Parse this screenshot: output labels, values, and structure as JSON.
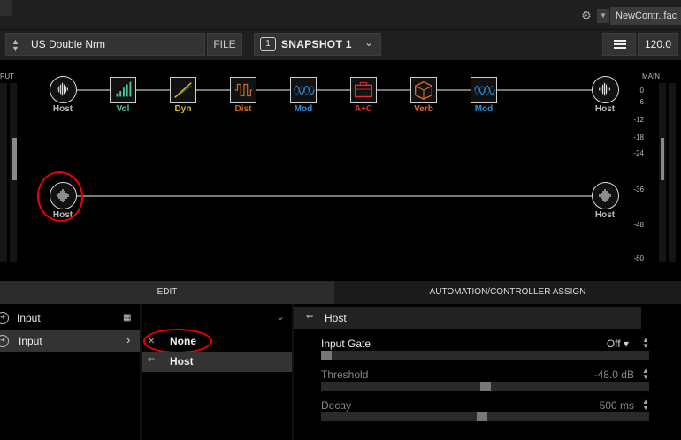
{
  "window": {
    "file_tab": "NewContr..fac"
  },
  "toolbar": {
    "preset_name": "US Double Nrm",
    "file_label": "FILE",
    "snapshot_label": "SNAPSHOT 1",
    "snapshot_icon": "1",
    "tempo": "120.0"
  },
  "flow": {
    "input_header": "PUT",
    "main_header": "MAIN",
    "scale": [
      "0",
      "-6",
      "-12",
      "-18",
      "-24",
      "-36",
      "-48",
      "-60"
    ],
    "path1_blocks": [
      {
        "label": "Host",
        "color": "#bbbbbb",
        "icon": "waveform-icon"
      },
      {
        "label": "Vol",
        "color": "#4ec7a2",
        "icon": "volume-bars-icon"
      },
      {
        "label": "Dyn",
        "color": "#d9c22e",
        "icon": "dynamics-curve-icon"
      },
      {
        "label": "Dist",
        "color": "#c56b2a",
        "icon": "distortion-wave-icon"
      },
      {
        "label": "Mod",
        "color": "#2a8fd8",
        "icon": "modulation-wave-icon"
      },
      {
        "label": "A+C",
        "color": "#e0302a",
        "icon": "amp-cab-icon"
      },
      {
        "label": "Verb",
        "color": "#e06a2a",
        "icon": "reverb-cube-icon"
      },
      {
        "label": "Mod",
        "color": "#2a8fd8",
        "icon": "modulation-wave-icon"
      },
      {
        "label": "Host",
        "color": "#bbbbbb",
        "icon": "waveform-icon"
      }
    ],
    "path2_input_label": "Host",
    "path2_output_label": "Host"
  },
  "tabs": {
    "edit": "EDIT",
    "automation": "AUTOMATION/CONTROLLER ASSIGN"
  },
  "edit": {
    "col1": {
      "header": "Input",
      "item": "Input"
    },
    "col2": {
      "options": [
        "None",
        "Host"
      ]
    },
    "col3": {
      "title": "Host",
      "params": [
        {
          "label": "Input Gate",
          "value": "Off",
          "position": 0.0
        },
        {
          "label": "Threshold",
          "value": "-48.0 dB",
          "position": 0.5
        },
        {
          "label": "Decay",
          "value": "500 ms",
          "position": 0.49
        }
      ]
    }
  }
}
